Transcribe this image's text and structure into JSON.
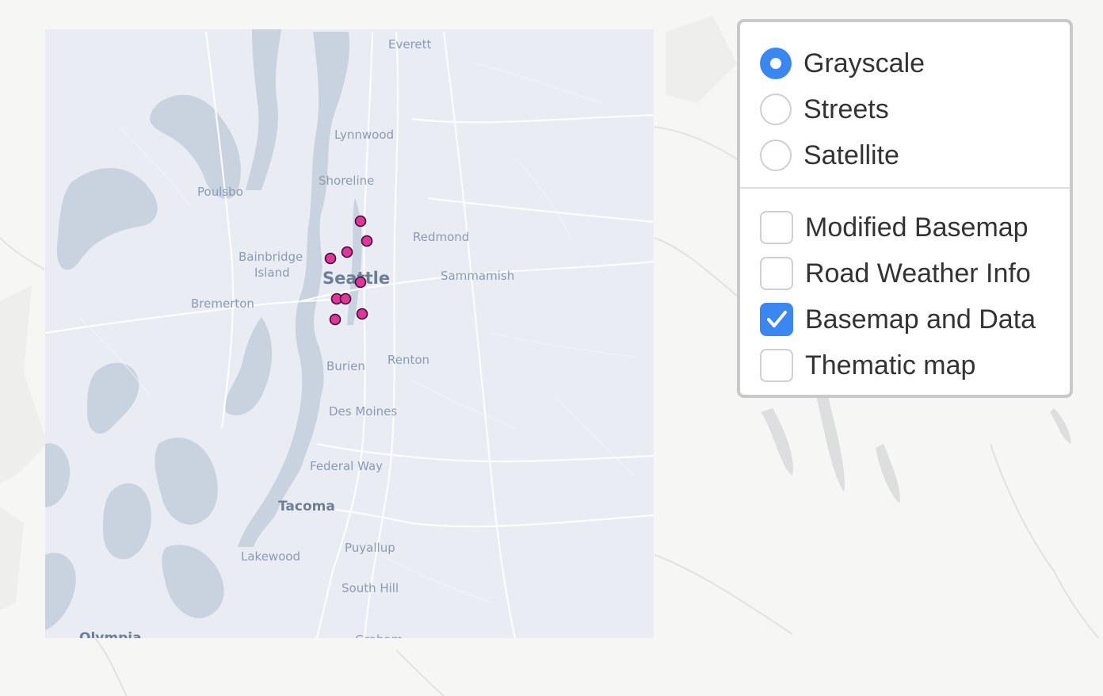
{
  "map": {
    "labels": {
      "everett": "Everett",
      "lynnwood": "Lynnwood",
      "shoreline": "Shoreline",
      "poulsbo": "Poulsbo",
      "redmond": "Redmond",
      "bainbridge_1": "Bainbridge",
      "bainbridge_2": "Island",
      "seattle": "Seattle",
      "sammamish": "Sammamish",
      "bremerton": "Bremerton",
      "burien": "Burien",
      "renton": "Renton",
      "des_moines": "Des Moines",
      "federal_way": "Federal Way",
      "tacoma": "Tacoma",
      "lakewood": "Lakewood",
      "puyallup": "Puyallup",
      "south_hill": "South Hill",
      "olympia": "Olympia",
      "graham": "Graham"
    },
    "markers": [
      {
        "name": "marker-1"
      },
      {
        "name": "marker-2"
      },
      {
        "name": "marker-3"
      },
      {
        "name": "marker-4"
      },
      {
        "name": "marker-5"
      },
      {
        "name": "marker-6"
      },
      {
        "name": "marker-7"
      },
      {
        "name": "marker-8"
      },
      {
        "name": "marker-9"
      }
    ],
    "colors": {
      "overlay": "#e9edf3",
      "water": "#c9d3df",
      "marker": "#e0359a",
      "accent": "#3b87f2"
    }
  },
  "layer_control": {
    "base_layers": [
      {
        "label": "Grayscale",
        "checked": true
      },
      {
        "label": "Streets",
        "checked": false
      },
      {
        "label": "Satellite",
        "checked": false
      }
    ],
    "overlays": [
      {
        "label": "Modified Basemap",
        "checked": false
      },
      {
        "label": "Road Weather Info",
        "checked": false
      },
      {
        "label": "Basemap and Data",
        "checked": true
      },
      {
        "label": "Thematic map",
        "checked": false
      }
    ]
  }
}
